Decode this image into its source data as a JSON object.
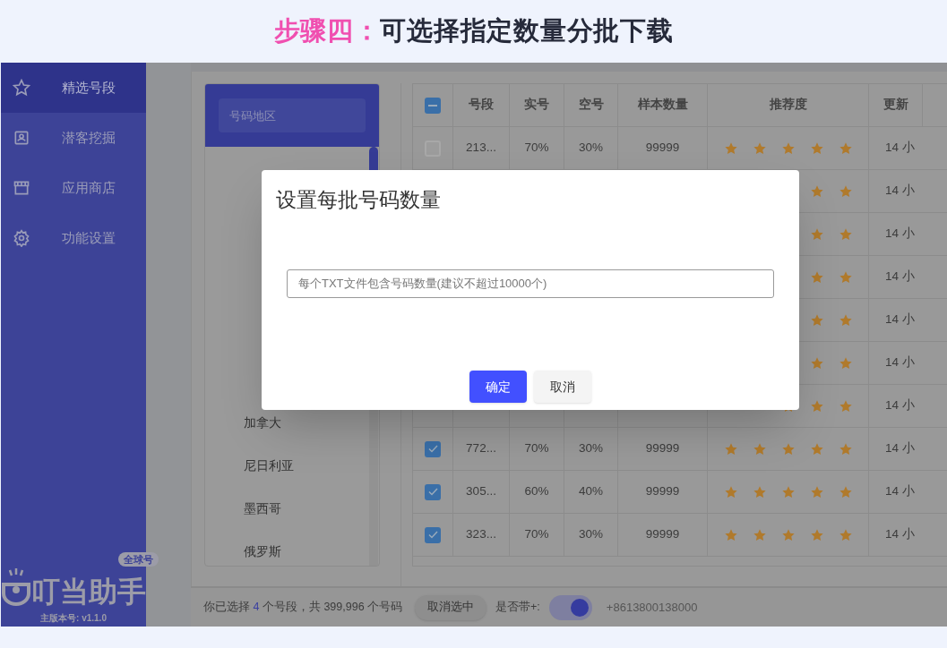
{
  "banner": {
    "step": "步骤四：",
    "title": "可选择指定数量分批下载"
  },
  "sidebar": {
    "items": [
      {
        "label": "精选号段",
        "selected": true
      },
      {
        "label": "潜客挖掘",
        "selected": false
      },
      {
        "label": "应用商店",
        "selected": false
      },
      {
        "label": "功能设置",
        "selected": false
      }
    ],
    "logo": {
      "name": "叮当助手",
      "badge": "全球号"
    },
    "version": "主版本号: v1.1.0"
  },
  "region_panel": {
    "search_placeholder": "号码地区",
    "items": [
      "加拿大",
      "尼日利亚",
      "墨西哥",
      "俄罗斯"
    ]
  },
  "table": {
    "header_indeterminate": true,
    "columns": [
      "号段",
      "实号",
      "空号",
      "样本数量",
      "推荐度",
      "更新"
    ],
    "rows": [
      {
        "checked": false,
        "cells": [
          "213...",
          "70%",
          "30%",
          "99999"
        ],
        "stars": 5,
        "time": "14 小"
      },
      {
        "time": "14 小"
      },
      {
        "time": "14 小"
      },
      {
        "time": "14 小"
      },
      {
        "time": "14 小"
      },
      {
        "time": "14 小"
      },
      {
        "time": "14 小"
      },
      {
        "checked": true,
        "cells": [
          "772...",
          "70%",
          "30%",
          "99999"
        ],
        "stars": 5,
        "time": "14 小"
      },
      {
        "checked": true,
        "cells": [
          "305...",
          "60%",
          "40%",
          "99999"
        ],
        "stars": 5,
        "time": "14 小"
      },
      {
        "checked": true,
        "cells": [
          "323...",
          "70%",
          "30%",
          "99999"
        ],
        "stars": 5,
        "time": "14 小"
      }
    ]
  },
  "footer": {
    "summary_before": "你已选择",
    "count": "4",
    "summary_after": "个号段，共 399,996 个号码",
    "clear_button": "取消选中",
    "plus_label": "是否带+:",
    "plus_on": true,
    "example": "+8613800138000"
  },
  "dialog": {
    "title": "设置每批号码数量",
    "placeholder": "每个TXT文件包含号码数量(建议不超过10000个)",
    "buttons": [
      {
        "label": "确定",
        "kind": "primary"
      },
      {
        "label": "取消",
        "kind": "secondary"
      }
    ]
  }
}
